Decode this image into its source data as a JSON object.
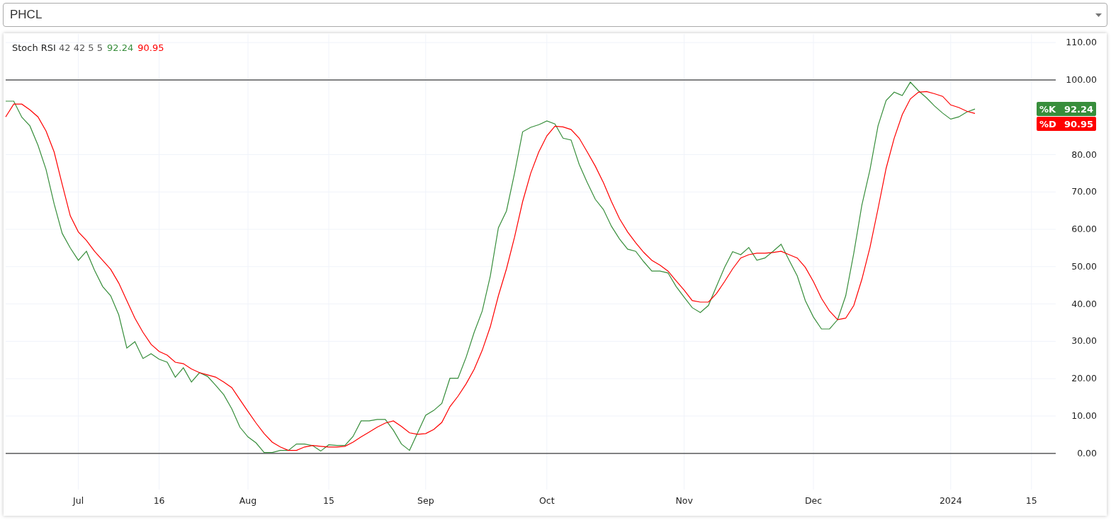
{
  "symbol_select": {
    "value": "PHCL"
  },
  "legend": {
    "name": "Stoch RSI",
    "params": "42 42 5 5",
    "values": [
      {
        "text": "92.24",
        "color": "#388e3c"
      },
      {
        "text": "90.95",
        "color": "#ff0000"
      }
    ]
  },
  "price_labels": [
    {
      "value": "92.24",
      "color": "#388e3c"
    },
    {
      "value": "90.95",
      "color": "#ff0000"
    }
  ],
  "chart_data": {
    "type": "line",
    "categories": [
      null,
      null,
      null,
      null,
      null,
      null,
      null,
      null,
      null,
      "Jul",
      null,
      null,
      null,
      null,
      null,
      null,
      null,
      null,
      null,
      "16",
      null,
      null,
      null,
      null,
      null,
      null,
      null,
      null,
      null,
      null,
      "Aug",
      null,
      null,
      null,
      null,
      null,
      null,
      null,
      null,
      null,
      "15",
      null,
      null,
      null,
      null,
      null,
      null,
      null,
      null,
      null,
      null,
      null,
      "Sep",
      null,
      null,
      null,
      null,
      null,
      null,
      null,
      null,
      null,
      null,
      null,
      null,
      null,
      null,
      "Oct",
      null,
      null,
      null,
      null,
      null,
      null,
      null,
      null,
      null,
      null,
      null,
      null,
      null,
      null,
      null,
      null,
      "Nov",
      null,
      null,
      null,
      null,
      null,
      null,
      null,
      null,
      null,
      null,
      null,
      null,
      null,
      null,
      null,
      "Dec",
      null,
      null,
      null,
      null,
      null,
      null,
      null,
      null,
      null,
      null,
      null,
      null,
      null,
      null,
      null,
      null,
      "2024",
      null,
      null,
      null,
      null,
      null,
      null,
      null,
      null,
      null,
      "15",
      null,
      null,
      null
    ],
    "series": [
      {
        "name": "%K",
        "color": "#388e3c",
        "values": [
          94.3,
          94.3,
          90,
          87.7,
          82.5,
          76,
          66.8,
          58.9,
          55,
          51.7,
          54.1,
          49,
          44.7,
          42.2,
          37.1,
          28.2,
          29.9,
          25.4,
          26.7,
          25.2,
          24.4,
          20.4,
          22.9,
          19.1,
          21.6,
          20.6,
          18.2,
          15.7,
          11.9,
          7,
          4.4,
          2.8,
          0.2,
          0.2,
          0.8,
          0.8,
          2.5,
          2.5,
          2.1,
          0.6,
          2.3,
          2.1,
          2.1,
          4.5,
          8.7,
          8.7,
          9.1,
          9.1,
          6.2,
          2.5,
          0.8,
          5.5,
          10.2,
          11.5,
          13.4,
          20.1,
          20.1,
          25.7,
          32.4,
          38.1,
          47.5,
          60.4,
          64.9,
          75,
          86.1,
          87.3,
          88,
          89,
          88.2,
          84.4,
          83.9,
          77.4,
          72.5,
          68,
          65.3,
          60.8,
          57.4,
          54.7,
          54.1,
          51.3,
          48.8,
          48.8,
          48.3,
          44.7,
          41.8,
          39,
          37.7,
          39.6,
          44.7,
          49.8,
          54,
          53.2,
          55.1,
          51.7,
          52.3,
          54.1,
          56,
          51.7,
          47.5,
          40.9,
          36.5,
          33.3,
          33.3,
          35.8,
          42.2,
          53.6,
          66.5,
          75.9,
          87.7,
          94.5,
          96.7,
          95.8,
          99.4,
          97.1,
          95.2,
          93,
          91.1,
          89.5,
          90.1,
          91.4,
          92.2,
          null,
          null,
          null,
          null,
          null,
          null,
          null,
          null,
          null,
          null
        ]
      },
      {
        "name": "%D",
        "color": "#ff0000",
        "values": [
          90.1,
          93.5,
          93.5,
          92,
          90.1,
          86.3,
          80.7,
          72,
          63.6,
          59.3,
          57,
          54.1,
          51.7,
          49.3,
          45.6,
          40.9,
          36.2,
          32.4,
          29.2,
          27.3,
          26.3,
          24.4,
          24,
          22.6,
          21.6,
          21,
          20.4,
          19.1,
          17.6,
          14.4,
          11.2,
          8.1,
          5.3,
          3,
          1.7,
          0.8,
          0.8,
          1.7,
          2.1,
          1.9,
          1.7,
          1.7,
          1.9,
          3,
          4.4,
          5.7,
          7,
          8.1,
          8.7,
          7.2,
          5.5,
          5.1,
          5.3,
          6.4,
          8.3,
          12.5,
          15.3,
          18.6,
          22.5,
          27.6,
          33.9,
          42.2,
          49.4,
          57.9,
          67.4,
          75,
          80.7,
          85,
          87.6,
          87.4,
          86.7,
          84.4,
          80.7,
          76.9,
          72.5,
          67.4,
          62.8,
          59.3,
          56.4,
          53.8,
          51.7,
          50.4,
          48.8,
          46.2,
          43.7,
          40.9,
          40.5,
          40.5,
          42.8,
          46,
          49.4,
          52.3,
          53.2,
          53.6,
          53.6,
          53.8,
          54.1,
          53.2,
          52.3,
          49.8,
          46,
          41.5,
          38.1,
          35.8,
          36.2,
          39.6,
          46.6,
          55.1,
          65.5,
          76.3,
          84.4,
          90.7,
          94.9,
          96.7,
          96.9,
          96.3,
          95.6,
          93.3,
          92.6,
          91.6,
          91,
          null,
          null,
          null,
          null,
          null,
          null,
          null,
          null,
          null,
          null
        ]
      }
    ],
    "ylim": [
      -9.7,
      112.3
    ],
    "grid": true,
    "yticks": [
      {
        "value": 0,
        "label": "0.00"
      },
      {
        "value": 10,
        "label": "10.00"
      },
      {
        "value": 20,
        "label": "20.00"
      },
      {
        "value": 30,
        "label": "30.00"
      },
      {
        "value": 40,
        "label": "40.00"
      },
      {
        "value": 50,
        "label": "50.00"
      },
      {
        "value": 60,
        "label": "60.00"
      },
      {
        "value": 70,
        "label": "70.00"
      },
      {
        "value": 80,
        "label": "80.00"
      },
      {
        "value": 100,
        "label": "100.00"
      },
      {
        "value": 110,
        "label": "110.00"
      }
    ],
    "ref_lines": [
      {
        "axis": "y",
        "value": 100
      },
      {
        "axis": "y",
        "value": 0
      }
    ]
  }
}
